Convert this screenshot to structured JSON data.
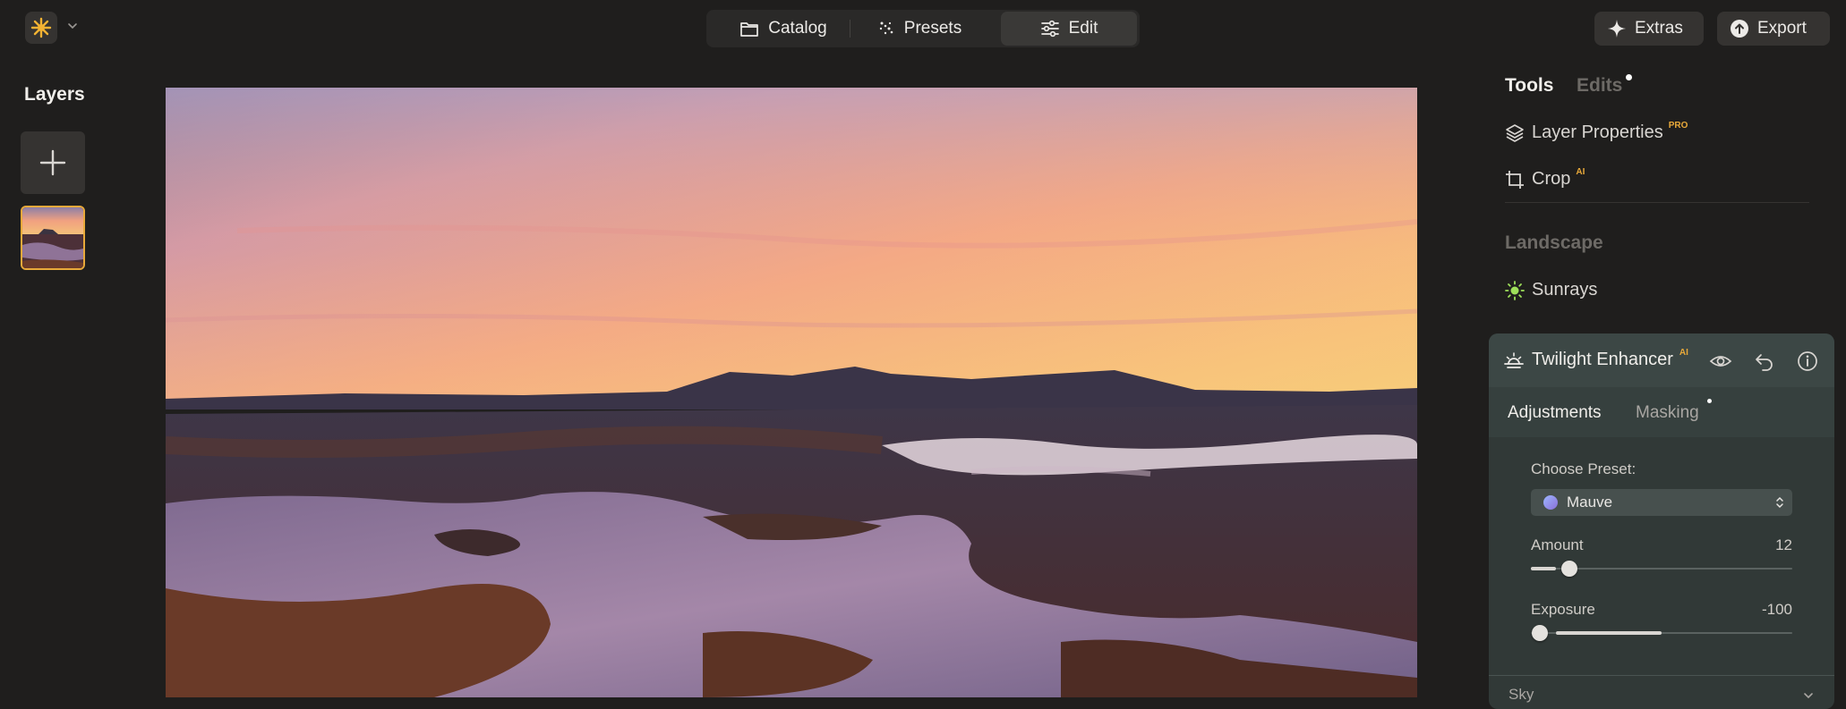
{
  "top_bar": {
    "nav": [
      {
        "label": "Catalog",
        "icon": "folder-icon"
      },
      {
        "label": "Presets",
        "icon": "sparkle-dots-icon"
      },
      {
        "label": "Edit",
        "icon": "sliders-icon",
        "active": true
      }
    ],
    "extras_label": "Extras",
    "export_label": "Export"
  },
  "layers": {
    "title": "Layers"
  },
  "panel": {
    "tab_tools": "Tools",
    "tab_edits": "Edits",
    "tools": [
      {
        "label": "Layer Properties",
        "badge": "PRO",
        "icon": "layers-icon"
      },
      {
        "label": "Crop",
        "badge": "AI",
        "icon": "crop-icon"
      }
    ],
    "section_title": "Landscape",
    "sunrays_label": "Sunrays",
    "twilight": {
      "title": "Twilight Enhancer",
      "badge": "AI",
      "tab_adjustments": "Adjustments",
      "tab_masking": "Masking",
      "preset_label": "Choose Preset:",
      "preset_value": "Mauve",
      "amount_label": "Amount",
      "amount_value": "12",
      "exposure_label": "Exposure",
      "exposure_value": "-100",
      "sky_label": "Sky"
    }
  },
  "colors": {
    "accent": "#e8a93a",
    "sunrays_icon": "#9ee05a",
    "card_bg": "#313937"
  }
}
